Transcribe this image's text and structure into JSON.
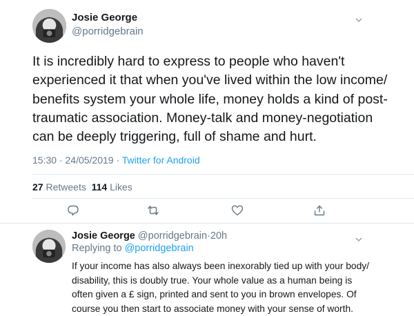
{
  "tweet": {
    "author_name": "Josie George",
    "author_handle": "@porridgebrain",
    "text": "It is incredibly hard to express to people who haven't experienced it that when you've lived within the low income/ benefits system your whole life, money holds a kind of post-traumatic association. Money-talk and money-negotiation can be deeply triggering, full of shame and hurt.",
    "time": "15:30",
    "separator": "·",
    "date": "24/05/2019",
    "source": "Twitter for Android",
    "retweets_count": "27",
    "retweets_label": "Retweets",
    "likes_count": "114",
    "likes_label": "Likes"
  },
  "actions": [
    {
      "icon": "reply-icon"
    },
    {
      "icon": "retweet-icon"
    },
    {
      "icon": "like-icon"
    },
    {
      "icon": "share-icon"
    }
  ],
  "reply": {
    "author_name": "Josie George",
    "author_handle": "@porridgebrain",
    "separator": "·",
    "time_ago": "20h",
    "replying_prefix": "Replying to",
    "replying_handle": "@porridgebrain",
    "text": "If your income has also always been inexorably tied up with your body/ disability, this is doubly true. Your whole value as a human being is often given a £ sign, printed and sent to you in brown envelopes. Of course you then start to associate money with your sense of worth."
  },
  "colors": {
    "text": "#14171a",
    "secondary": "#657786",
    "link": "#1da1f2",
    "divider": "#e1e8ed"
  }
}
